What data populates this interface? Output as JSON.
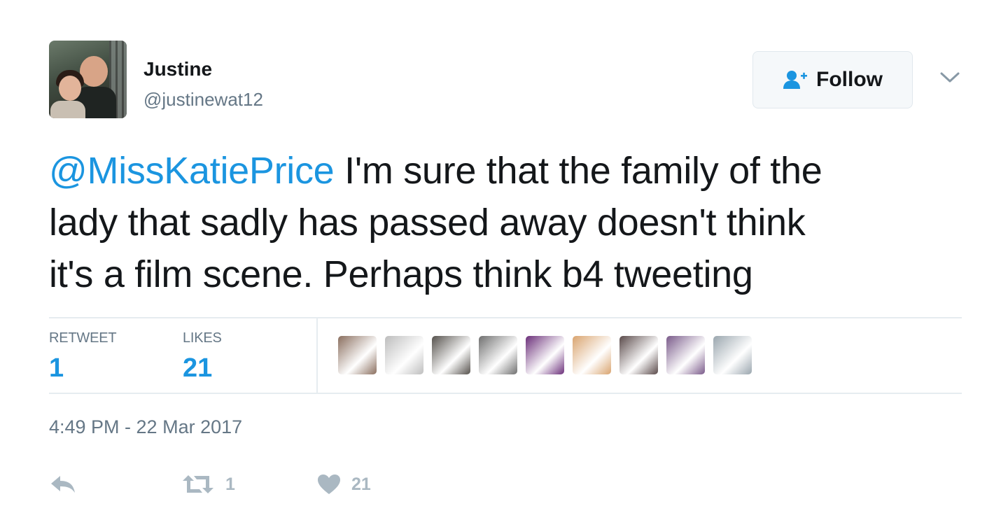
{
  "user": {
    "display_name": "Justine",
    "handle": "@justinewat12",
    "avatar_icon": "avatar-photo"
  },
  "follow_button": {
    "label": "Follow",
    "icon": "follow-user-icon"
  },
  "menu_icon": "chevron-down-icon",
  "tweet": {
    "mention": "@MissKatiePrice",
    "text_line1": " I'm sure that the family of the",
    "text_line2": "lady that sadly has passed away doesn't think",
    "text_line3": "it's a film scene. Perhaps think b4 tweeting"
  },
  "stats": {
    "retweet_label": "RETWEET",
    "retweet_count": "1",
    "likes_label": "LIKES",
    "likes_count": "21"
  },
  "likers": [
    {
      "name": "liker-avatar-1",
      "color": "#8a6e5e"
    },
    {
      "name": "liker-avatar-2",
      "color": "#bdbdbd"
    },
    {
      "name": "liker-avatar-3",
      "color": "#55514c"
    },
    {
      "name": "liker-avatar-4",
      "color": "#6f6f6f"
    },
    {
      "name": "liker-avatar-5",
      "color": "#6b2f7a"
    },
    {
      "name": "liker-avatar-6",
      "color": "#d9a46f"
    },
    {
      "name": "liker-avatar-7",
      "color": "#5a4a4a"
    },
    {
      "name": "liker-avatar-8",
      "color": "#7a5a8a"
    },
    {
      "name": "liker-avatar-9",
      "color": "#9aa6ae"
    }
  ],
  "timestamp": "4:49 PM - 22 Mar 2017",
  "actions": {
    "reply_icon": "reply-icon",
    "retweet_icon": "retweet-icon",
    "retweet_count": "1",
    "like_icon": "heart-icon",
    "like_count": "21"
  },
  "colors": {
    "accent": "#1b95e0",
    "secondary_text": "#657786",
    "action_gray": "#aab8c2",
    "divider": "#e6ecf0"
  }
}
